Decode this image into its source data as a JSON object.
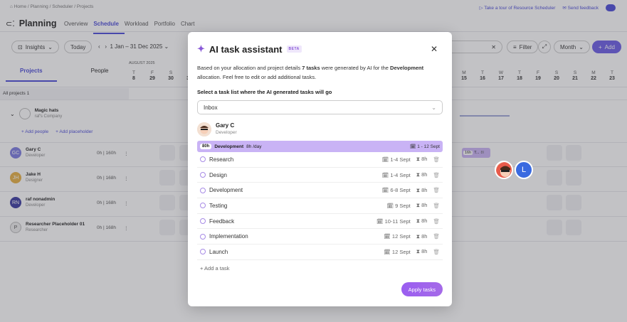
{
  "breadcrumb": "⌂ Home / Planning / Scheduler / Projects",
  "toplinks": {
    "tour": "▷ Take a tour of Resource Scheduler",
    "feedback": "✉ Send feedback"
  },
  "page": {
    "title": "Planning"
  },
  "tabs": [
    "Overview",
    "Schedule",
    "Workload",
    "Portfolio",
    "Chart"
  ],
  "toolbar": {
    "insights": "Insights",
    "today": "Today",
    "daterange": "1 Jan – 31 Dec 2025",
    "filter": "Filter",
    "month": "Month",
    "add": "Add"
  },
  "grid": {
    "month_label": "AUGUST 2025",
    "projects_tab": "Projects",
    "people_tab": "People",
    "all_projects": "All projects  1",
    "left_days": [
      {
        "d": "T",
        "n": "8"
      },
      {
        "d": "F",
        "n": "29"
      },
      {
        "d": "S",
        "n": "30"
      },
      {
        "d": "S",
        "n": "31"
      }
    ],
    "right_days": [
      {
        "d": "M",
        "n": "15"
      },
      {
        "d": "T",
        "n": "16"
      },
      {
        "d": "W",
        "n": "17"
      },
      {
        "d": "T",
        "n": "18"
      },
      {
        "d": "F",
        "n": "19"
      },
      {
        "d": "S",
        "n": "20"
      },
      {
        "d": "S",
        "n": "21"
      },
      {
        "d": "M",
        "n": "22"
      },
      {
        "d": "T",
        "n": "23"
      }
    ]
  },
  "project": {
    "name": "Magic hats",
    "company": "raf's Company",
    "add_people": "+ Add people",
    "add_placeholder": "+ Add placeholder"
  },
  "resources": [
    {
      "initials": "GC",
      "name": "Gary C",
      "role": "Developer",
      "cap": "0h | 160h",
      "color": "#7b7be0"
    },
    {
      "initials": "JH",
      "name": "Jake H",
      "role": "Designer",
      "cap": "0h | 168h",
      "color": "#e8b042"
    },
    {
      "initials": "RN",
      "name": "raf nonadmin",
      "role": "Developer",
      "cap": "0h | 168h",
      "color": "#3a3aa0"
    },
    {
      "initials": "P",
      "name": "Researcher Placeholder 01",
      "role": "Researcher",
      "cap": "0h | 168h",
      "color": "#eeeeee"
    }
  ],
  "bar_label": {
    "hrs": "16h",
    "text": "T...",
    "extra": "8l"
  },
  "modal": {
    "title": "AI task assistant",
    "badge": "BETA",
    "desc_pre": "Based on your allocation and project details ",
    "desc_bold": "7 tasks",
    "desc_mid": " were generated by AI for the ",
    "desc_bold2": "Development",
    "desc_post": " allocation. Feel free to edit or add additional tasks.",
    "select_label": "Select a task list where the AI generated tasks will go",
    "select_value": "Inbox",
    "person_name": "Gary C",
    "person_role": "Developer",
    "alloc_hours": "80h",
    "alloc_name": "Development",
    "alloc_rate": "8h /day",
    "alloc_dates": "1 - 12 Sept",
    "tasks": [
      {
        "name": "Research",
        "dates": "1-4 Sept",
        "hours": "8h"
      },
      {
        "name": "Design",
        "dates": "1-4 Sept",
        "hours": "8h"
      },
      {
        "name": "Development",
        "dates": "6-8 Sept",
        "hours": "8h"
      },
      {
        "name": "Testing",
        "dates": "9 Sept",
        "hours": "8h"
      },
      {
        "name": "Feedback",
        "dates": "10-11 Sept",
        "hours": "8h"
      },
      {
        "name": "Implementation",
        "dates": "12 Sept",
        "hours": "8h"
      },
      {
        "name": "Launch",
        "dates": "12 Sept",
        "hours": "8h"
      }
    ],
    "add_task": "+ Add a task",
    "apply": "Apply tasks"
  },
  "floating_avatar": {
    "letter": "L"
  }
}
